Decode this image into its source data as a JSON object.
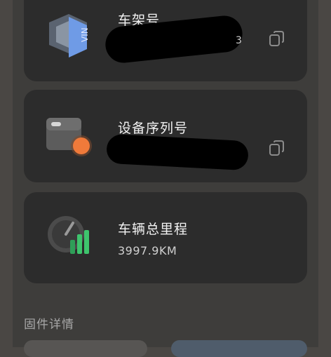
{
  "vin_card": {
    "title": "车架号",
    "value_suffix": "3",
    "icon": "vin-icon",
    "icon_text": "VIN",
    "copy_icon": "copy-icon"
  },
  "serial_card": {
    "title": "设备序列号",
    "icon": "device-icon",
    "copy_icon": "copy-icon"
  },
  "mileage_card": {
    "title": "车辆总里程",
    "value": "3997.9KM",
    "icon": "gauge-icon"
  },
  "firmware_section": {
    "title": "固件详情"
  },
  "colors": {
    "card_bg": "#2c2c2c",
    "accent_orange": "#f07a3a",
    "accent_green": "#3ec46d",
    "vin_blue": "#6f9be6"
  }
}
